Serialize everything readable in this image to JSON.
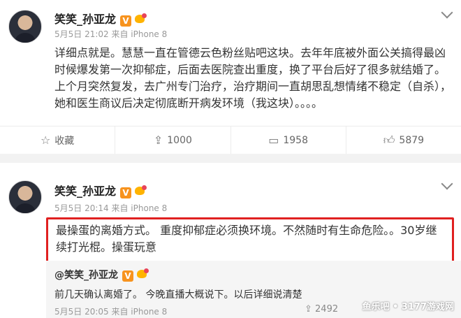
{
  "post1": {
    "username": "笑笑_孙亚龙",
    "vbadge": "V",
    "meta": "5月5日 21:02 来自 iPhone 8",
    "content": "详细点就是。慧慧一直在管德云色粉丝贴吧这块。去年年底被外面公关搞得最凶时候爆发第一次抑郁症，后面去医院查出重度，换了平台后好了很多就结婚了。上个月突然复发，去广州专门治疗，治疗期间一直胡思乱想情绪不稳定（自杀），她和医生商议后决定彻底断开病发环境（我这块）。。。。",
    "actions": {
      "favorite": "收藏",
      "forward": "1000",
      "comment": "1958",
      "like": "5879"
    }
  },
  "post2": {
    "username": "笑笑_孙亚龙",
    "vbadge": "V",
    "meta": "5月5日 20:14 来自 iPhone 8",
    "content": "最操蛋的离婚方式。 重度抑郁症必须换环境。不然随时有生命危险。。30岁继续打光棍。操蛋玩意",
    "repost": {
      "author": "@笑笑_孙亚龙",
      "text": "前几天确认离婚了。 今晚直播大概说下。以后详细说清楚",
      "meta": "5月5日 20:05 来自 iPhone 8",
      "forward_count": "2492"
    }
  },
  "watermark": "鱼乐吧 • 3177游戏网",
  "colors": {
    "highlight_border": "#e02020",
    "vbadge": "#f7931e",
    "background": "#f2f2f2"
  }
}
